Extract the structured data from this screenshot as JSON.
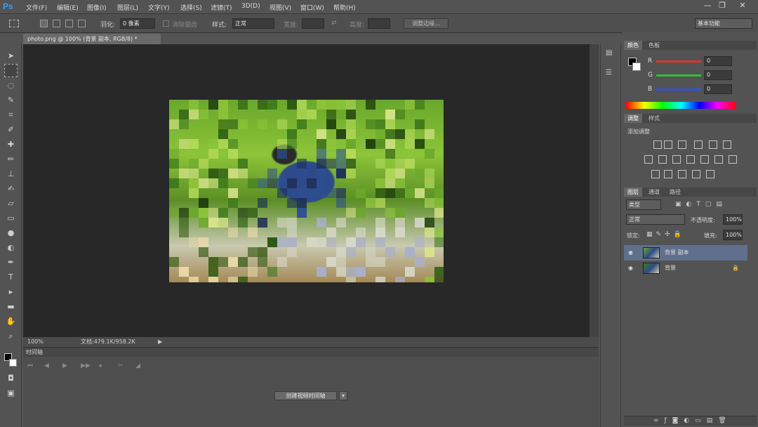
{
  "app": {
    "logo": "Ps",
    "workspace": "基本功能"
  },
  "menu": [
    "文件(F)",
    "编辑(E)",
    "图像(I)",
    "图层(L)",
    "文字(Y)",
    "选择(S)",
    "滤镜(T)",
    "3D(D)",
    "视图(V)",
    "窗口(W)",
    "帮助(H)"
  ],
  "window_controls": {
    "min": "—",
    "restore": "❐",
    "close": "✕"
  },
  "options": {
    "feather_label": "羽化:",
    "feather_value": "0 像素",
    "antialias_label": "消除锯齿",
    "style_label": "样式:",
    "style_value": "正常",
    "width_label": "宽度:",
    "height_label": "高度:",
    "refine_label": "调整边缘..."
  },
  "document": {
    "tab_title": "photo.png @ 100% (背景 副本, RGB/8) *",
    "zoom": "100%",
    "doc_info": "文档:479.1K/958.2K"
  },
  "timeline": {
    "title": "时间轴",
    "create_button": "创建视频时间轴"
  },
  "color_panel": {
    "tabs": [
      "颜色",
      "色板"
    ],
    "channels": [
      {
        "label": "R",
        "value": "0",
        "color": "#e03030"
      },
      {
        "label": "G",
        "value": "0",
        "color": "#30c030"
      },
      {
        "label": "B",
        "value": "0",
        "color": "#3050e0"
      }
    ]
  },
  "adjustments_panel": {
    "tabs": [
      "调整",
      "样式"
    ],
    "subtitle": "添加调整"
  },
  "layers_panel": {
    "tabs": [
      "图层",
      "通道",
      "路径"
    ],
    "filter_kind": "类型",
    "blend_mode": "正常",
    "opacity_label": "不透明度:",
    "opacity_value": "100%",
    "lock_label": "锁定:",
    "fill_label": "填充:",
    "fill_value": "100%",
    "layers": [
      {
        "name": "背景 副本",
        "selected": true
      },
      {
        "name": "背景",
        "selected": false,
        "locked": true
      }
    ]
  }
}
